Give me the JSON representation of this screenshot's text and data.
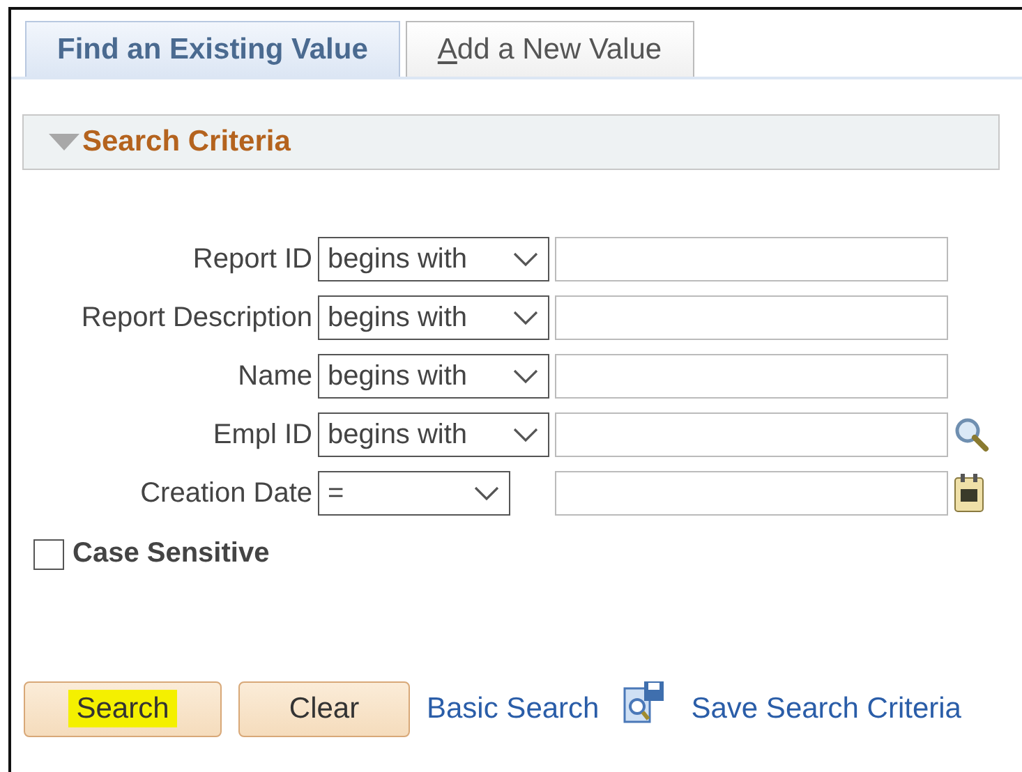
{
  "tabs": [
    {
      "label": "Find an Existing Value",
      "selected": true,
      "underline_first": false
    },
    {
      "label": "Add a New Value",
      "selected": false,
      "underline_first": true
    }
  ],
  "section": {
    "title": "Search Criteria",
    "expanded": true
  },
  "fields": [
    {
      "label": "Report ID",
      "operator": "begins with",
      "kind": "text"
    },
    {
      "label": "Report Description",
      "operator": "begins with",
      "kind": "text"
    },
    {
      "label": "Name",
      "operator": "begins with",
      "kind": "text"
    },
    {
      "label": "Empl ID",
      "operator": "begins with",
      "kind": "lookup"
    },
    {
      "label": "Creation Date",
      "operator": "=",
      "kind": "date"
    }
  ],
  "case_sensitive": {
    "label": "Case Sensitive",
    "checked": false
  },
  "buttons": [
    {
      "label": "Search",
      "highlighted": true
    },
    {
      "label": "Clear",
      "highlighted": false
    }
  ],
  "links": [
    {
      "label": "Basic Search",
      "kind": "plain"
    },
    {
      "label": "Save Search Criteria",
      "kind": "save"
    }
  ]
}
